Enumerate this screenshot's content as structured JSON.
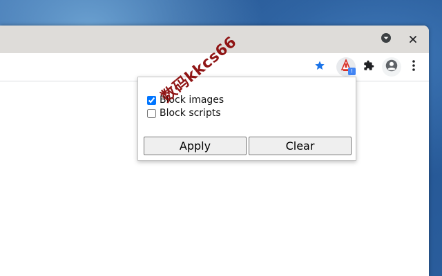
{
  "popup": {
    "options": [
      {
        "label": "Block images",
        "checked": true
      },
      {
        "label": "Block scripts",
        "checked": false
      }
    ],
    "apply_label": "Apply",
    "clear_label": "Clear"
  },
  "extension": {
    "badge_text": "!"
  },
  "watermark": "数码kkcs66",
  "colors": {
    "star": "#1a73e8",
    "badge": "#4285f4",
    "titlebar": "#dedcd9",
    "watermark": "#8b0a0a"
  },
  "icons": [
    "chevron-down-icon",
    "close-icon",
    "bookmark-star-icon",
    "extension-icon",
    "puzzle-icon",
    "profile-icon",
    "kebab-menu-icon"
  ]
}
